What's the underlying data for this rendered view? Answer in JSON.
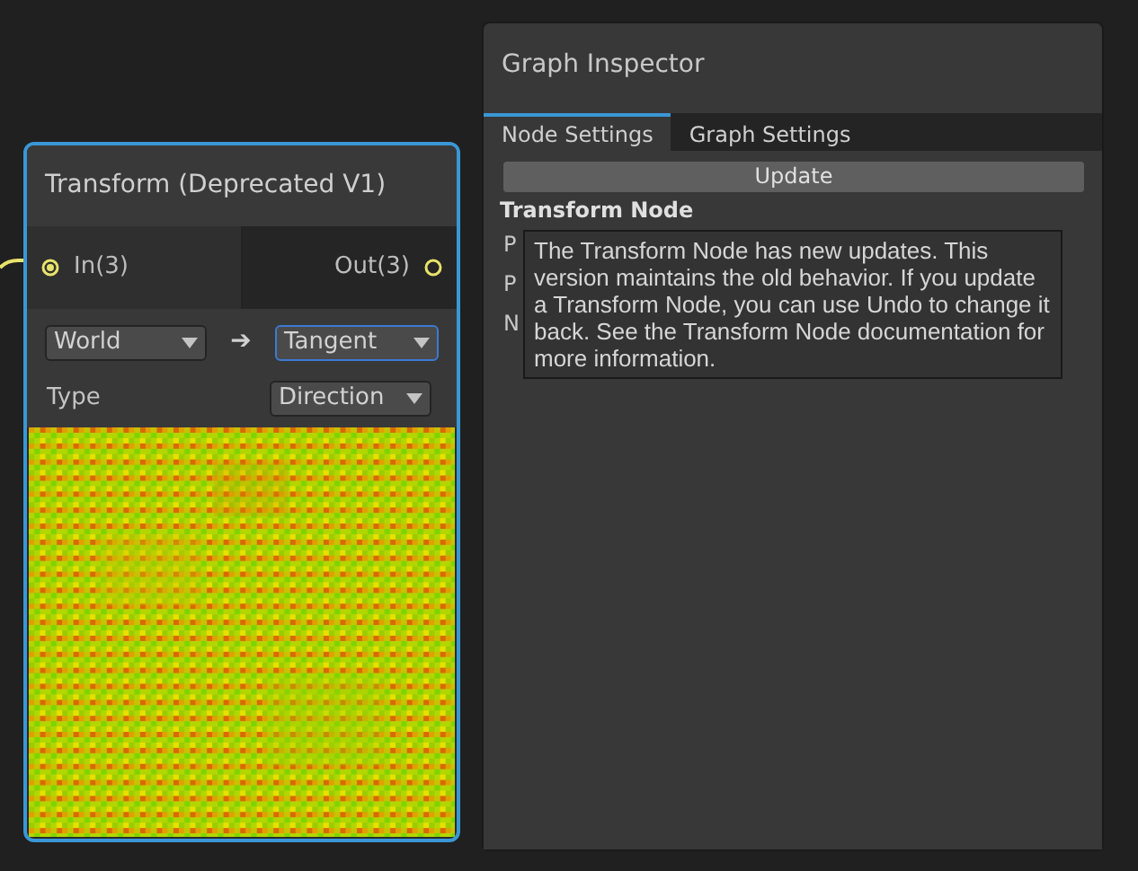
{
  "node": {
    "title": "Transform (Deprecated V1)",
    "ports": [
      {
        "label": "In(3)",
        "kind": "input",
        "connected": true
      },
      {
        "label": "Out(3)",
        "kind": "output",
        "connected": false
      }
    ],
    "from_space": {
      "value": "World",
      "focused": false
    },
    "arrow": "➔",
    "to_space": {
      "value": "Tangent",
      "focused": true
    },
    "type_label": "Type",
    "type_value": {
      "value": "Direction",
      "focused": false
    }
  },
  "inspector": {
    "title": "Graph Inspector",
    "tabs": [
      {
        "label": "Node Settings",
        "selected": true
      },
      {
        "label": "Graph Settings",
        "selected": false
      }
    ],
    "update_button": "Update",
    "section_title": "Transform Node",
    "field_labels": [
      "P",
      "P",
      "N"
    ],
    "tooltip": "The Transform Node has new updates. This version maintains the old behavior. If you update a Transform Node, you can use Undo to change it back. See the Transform Node documentation for more information."
  }
}
